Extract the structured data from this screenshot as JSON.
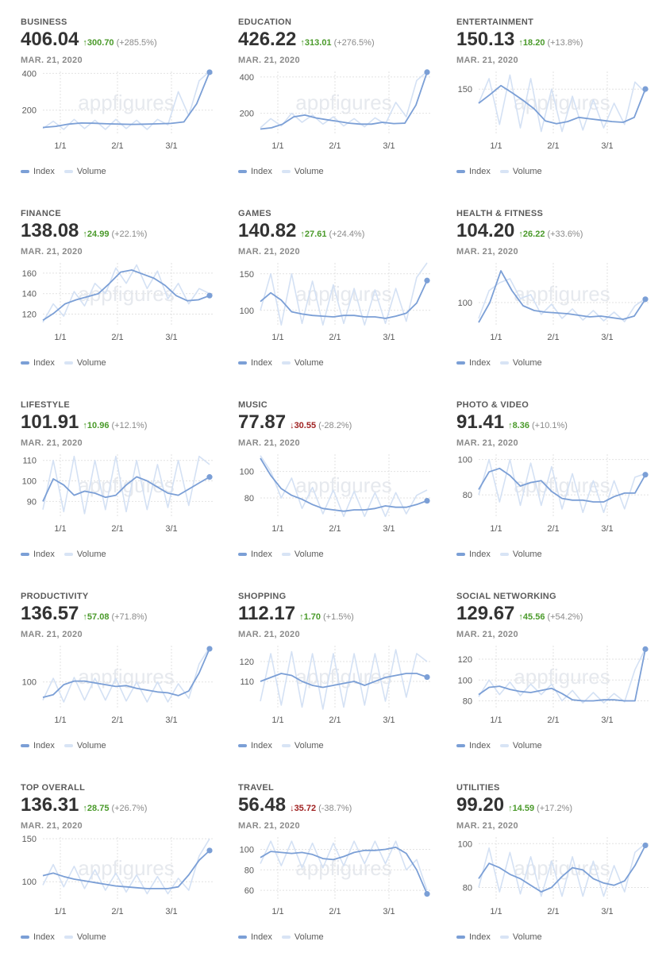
{
  "colors": {
    "index": "#7b9fd6",
    "volume": "#d4e1f4",
    "up": "#4a9a2a",
    "down": "#a02222",
    "grid": "#e2e2e2"
  },
  "icons": {
    "up": "↑",
    "down": "↓"
  },
  "panels": [
    {
      "category": "BUSINESS",
      "value": "406.04",
      "dir": "up",
      "change": "300.70",
      "pct": "(+285.5%)",
      "date": "MAR. 21, 2020",
      "legend": [
        "Index",
        "Volume"
      ],
      "watermark": "appfigures"
    },
    {
      "category": "EDUCATION",
      "value": "426.22",
      "dir": "up",
      "change": "313.01",
      "pct": "(+276.5%)",
      "date": "MAR. 21, 2020",
      "legend": [
        "Index",
        "Volume"
      ],
      "watermark": "appfigures"
    },
    {
      "category": "ENTERTAINMENT",
      "value": "150.13",
      "dir": "up",
      "change": "18.20",
      "pct": "(+13.8%)",
      "date": "MAR. 21, 2020",
      "legend": [
        "Index",
        "Volume"
      ],
      "watermark": "appfigures"
    },
    {
      "category": "FINANCE",
      "value": "138.08",
      "dir": "up",
      "change": "24.99",
      "pct": "(+22.1%)",
      "date": "MAR. 21, 2020",
      "legend": [
        "Index",
        "Volume"
      ],
      "watermark": "appfigures"
    },
    {
      "category": "GAMES",
      "value": "140.82",
      "dir": "up",
      "change": "27.61",
      "pct": "(+24.4%)",
      "date": "MAR. 21, 2020",
      "legend": [
        "Index",
        "Volume"
      ],
      "watermark": "appfigures"
    },
    {
      "category": "HEALTH & FITNESS",
      "value": "104.20",
      "dir": "up",
      "change": "26.22",
      "pct": "(+33.6%)",
      "date": "MAR. 21, 2020",
      "legend": [
        "Index",
        "Volume"
      ],
      "watermark": "appfigures"
    },
    {
      "category": "LIFESTYLE",
      "value": "101.91",
      "dir": "up",
      "change": "10.96",
      "pct": "(+12.1%)",
      "date": "MAR. 21, 2020",
      "legend": [
        "Index",
        "Volume"
      ],
      "watermark": "appfigures"
    },
    {
      "category": "MUSIC",
      "value": "77.87",
      "dir": "down",
      "change": "30.55",
      "pct": "(-28.2%)",
      "date": "MAR. 21, 2020",
      "legend": [
        "Index",
        "Volume"
      ],
      "watermark": "appfigures"
    },
    {
      "category": "PHOTO & VIDEO",
      "value": "91.41",
      "dir": "up",
      "change": "8.36",
      "pct": "(+10.1%)",
      "date": "MAR. 21, 2020",
      "legend": [
        "Index",
        "Volume"
      ],
      "watermark": "appfigures"
    },
    {
      "category": "PRODUCTIVITY",
      "value": "136.57",
      "dir": "up",
      "change": "57.08",
      "pct": "(+71.8%)",
      "date": "MAR. 21, 2020",
      "legend": [
        "Index",
        "Volume"
      ],
      "watermark": "appfigures"
    },
    {
      "category": "SHOPPING",
      "value": "112.17",
      "dir": "up",
      "change": "1.70",
      "pct": "(+1.5%)",
      "date": "MAR. 21, 2020",
      "legend": [
        "Index",
        "Volume"
      ],
      "watermark": "appfigures"
    },
    {
      "category": "SOCIAL NETWORKING",
      "value": "129.67",
      "dir": "up",
      "change": "45.56",
      "pct": "(+54.2%)",
      "date": "MAR. 21, 2020",
      "legend": [
        "Index",
        "Volume"
      ],
      "watermark": "appfigures"
    },
    {
      "category": "TOP OVERALL",
      "value": "136.31",
      "dir": "up",
      "change": "28.75",
      "pct": "(+26.7%)",
      "date": "MAR. 21, 2020",
      "legend": [
        "Index",
        "Volume"
      ],
      "watermark": "appfigures"
    },
    {
      "category": "TRAVEL",
      "value": "56.48",
      "dir": "down",
      "change": "35.72",
      "pct": "(-38.7%)",
      "date": "MAR. 21, 2020",
      "legend": [
        "Index",
        "Volume"
      ],
      "watermark": "appfigures"
    },
    {
      "category": "UTILITIES",
      "value": "99.20",
      "dir": "up",
      "change": "14.59",
      "pct": "(+17.2%)",
      "date": "MAR. 21, 2020",
      "legend": [
        "Index",
        "Volume"
      ],
      "watermark": "appfigures"
    }
  ],
  "chart_data": [
    {
      "type": "line",
      "title": "BUSINESS",
      "xticks": [
        "1/1",
        "2/1",
        "3/1"
      ],
      "yticks": [
        200,
        400
      ],
      "ylim": [
        65,
        410
      ],
      "series": [
        {
          "name": "Index",
          "values": [
            106,
            112,
            124,
            130,
            129,
            126,
            124,
            123,
            124,
            126,
            128,
            136,
            235,
            406.04
          ]
        },
        {
          "name": "Volume",
          "values": [
            100,
            140,
            95,
            150,
            100,
            145,
            95,
            150,
            100,
            145,
            95,
            150,
            120,
            300,
            170,
            360,
            410
          ]
        }
      ]
    },
    {
      "type": "line",
      "title": "EDUCATION",
      "xticks": [
        "1/1",
        "2/1",
        "3/1"
      ],
      "yticks": [
        200,
        400
      ],
      "ylim": [
        80,
        430
      ],
      "series": [
        {
          "name": "Index",
          "values": [
            113,
            120,
            140,
            180,
            190,
            174,
            164,
            155,
            145,
            140,
            140,
            150,
            143,
            145,
            245,
            426.22
          ]
        },
        {
          "name": "Volume",
          "values": [
            120,
            170,
            130,
            200,
            150,
            190,
            140,
            180,
            130,
            170,
            125,
            175,
            140,
            260,
            180,
            380,
            430
          ]
        }
      ]
    },
    {
      "type": "line",
      "title": "ENTERTAINMENT",
      "xticks": [
        "1/1",
        "2/1",
        "3/1"
      ],
      "yticks": [
        150
      ],
      "ylim": [
        85,
        175
      ],
      "series": [
        {
          "name": "Index",
          "values": [
            130,
            142,
            155,
            145,
            134,
            122,
            105,
            101,
            104,
            110,
            108,
            106,
            104,
            103,
            110,
            150.13
          ]
        },
        {
          "name": "Volume",
          "values": [
            130,
            165,
            100,
            170,
            95,
            165,
            90,
            150,
            90,
            140,
            92,
            135,
            95,
            130,
            100,
            160,
            145
          ]
        }
      ]
    },
    {
      "type": "line",
      "title": "FINANCE",
      "xticks": [
        "1/1",
        "2/1",
        "3/1"
      ],
      "yticks": [
        120,
        140,
        160
      ],
      "ylim": [
        108,
        170
      ],
      "series": [
        {
          "name": "Index",
          "values": [
            114,
            121,
            130,
            134,
            137,
            140,
            150,
            161,
            163,
            159,
            155,
            148,
            138,
            133,
            134,
            138.08
          ]
        },
        {
          "name": "Volume",
          "values": [
            112,
            130,
            118,
            142,
            128,
            150,
            140,
            165,
            150,
            168,
            145,
            162,
            135,
            150,
            130,
            145,
            140
          ]
        }
      ]
    },
    {
      "type": "line",
      "title": "GAMES",
      "xticks": [
        "1/1",
        "2/1",
        "3/1"
      ],
      "yticks": [
        100,
        150
      ],
      "ylim": [
        78,
        165
      ],
      "series": [
        {
          "name": "Index",
          "values": [
            112,
            124,
            114,
            98,
            95,
            93,
            92,
            91,
            93,
            93,
            91,
            91,
            89,
            92,
            96,
            110,
            140.82
          ]
        },
        {
          "name": "Volume",
          "values": [
            100,
            150,
            80,
            150,
            82,
            140,
            80,
            135,
            82,
            130,
            80,
            128,
            82,
            130,
            85,
            145,
            165
          ]
        }
      ]
    },
    {
      "type": "line",
      "title": "HEALTH & FITNESS",
      "xticks": [
        "1/1",
        "2/1",
        "3/1"
      ],
      "yticks": [
        100
      ],
      "ylim": [
        70,
        150
      ],
      "series": [
        {
          "name": "Index",
          "values": [
            75,
            100,
            140,
            115,
            96,
            90,
            88,
            87,
            86,
            84,
            82,
            83,
            81,
            79,
            83,
            104.2
          ]
        },
        {
          "name": "Volume",
          "values": [
            80,
            115,
            125,
            130,
            105,
            110,
            85,
            98,
            80,
            92,
            78,
            90,
            77,
            88,
            76,
            96,
            105
          ]
        }
      ]
    },
    {
      "type": "line",
      "title": "LIFESTYLE",
      "xticks": [
        "1/1",
        "2/1",
        "3/1"
      ],
      "yticks": [
        90,
        100,
        110
      ],
      "ylim": [
        82,
        113
      ],
      "series": [
        {
          "name": "Index",
          "values": [
            90,
            101,
            98,
            93,
            95,
            94,
            92,
            93,
            98,
            102,
            100,
            97,
            94,
            93,
            96,
            99,
            101.91
          ]
        },
        {
          "name": "Volume",
          "values": [
            86,
            110,
            85,
            112,
            84,
            110,
            86,
            112,
            85,
            110,
            86,
            108,
            87,
            110,
            88,
            112,
            108
          ]
        }
      ]
    },
    {
      "type": "line",
      "title": "MUSIC",
      "xticks": [
        "1/1",
        "2/1",
        "3/1"
      ],
      "yticks": [
        80,
        100
      ],
      "ylim": [
        65,
        113
      ],
      "series": [
        {
          "name": "Index",
          "values": [
            110,
            97,
            87,
            82,
            79,
            75,
            72,
            71,
            70,
            71,
            71,
            72,
            74,
            73,
            73,
            75,
            77.87
          ]
        },
        {
          "name": "Volume",
          "values": [
            112,
            100,
            80,
            95,
            72,
            88,
            68,
            86,
            66,
            85,
            66,
            84,
            66,
            84,
            68,
            82,
            86
          ]
        }
      ]
    },
    {
      "type": "line",
      "title": "PHOTO & VIDEO",
      "xticks": [
        "1/1",
        "2/1",
        "3/1"
      ],
      "yticks": [
        80,
        100
      ],
      "ylim": [
        67,
        103
      ],
      "series": [
        {
          "name": "Index",
          "values": [
            83,
            93,
            95,
            91,
            85,
            87,
            88,
            82,
            78,
            77,
            77,
            76,
            76,
            79,
            81,
            81,
            91.41
          ]
        },
        {
          "name": "Volume",
          "values": [
            80,
            100,
            76,
            100,
            74,
            98,
            74,
            96,
            72,
            92,
            70,
            88,
            70,
            88,
            72,
            90,
            92
          ]
        }
      ]
    },
    {
      "type": "line",
      "title": "PRODUCTIVITY",
      "xticks": [
        "1/1",
        "2/1",
        "3/1"
      ],
      "yticks": [
        100
      ],
      "ylim": [
        70,
        140
      ],
      "series": [
        {
          "name": "Index",
          "values": [
            83,
            86,
            97,
            101,
            101,
            99,
            97,
            95,
            96,
            93,
            91,
            89,
            88,
            85,
            90,
            110,
            136.57
          ]
        },
        {
          "name": "Volume",
          "values": [
            80,
            104,
            78,
            105,
            80,
            104,
            80,
            104,
            79,
            100,
            78,
            100,
            78,
            98,
            82,
            120,
            138
          ]
        }
      ]
    },
    {
      "type": "line",
      "title": "SHOPPING",
      "xticks": [
        "1/1",
        "2/1",
        "3/1"
      ],
      "yticks": [
        110,
        120
      ],
      "ylim": [
        96,
        128
      ],
      "series": [
        {
          "name": "Index",
          "values": [
            110,
            112,
            114,
            113,
            110,
            108,
            107,
            108,
            109,
            110,
            108,
            110,
            112,
            113,
            114,
            114,
            112.17
          ]
        },
        {
          "name": "Volume",
          "values": [
            100,
            124,
            98,
            125,
            97,
            124,
            96,
            124,
            97,
            124,
            98,
            124,
            100,
            126,
            102,
            124,
            120
          ]
        }
      ]
    },
    {
      "type": "line",
      "title": "SOCIAL NETWORKING",
      "xticks": [
        "1/1",
        "2/1",
        "3/1"
      ],
      "yticks": [
        80,
        100,
        120
      ],
      "ylim": [
        72,
        133
      ],
      "series": [
        {
          "name": "Index",
          "values": [
            86,
            93,
            94,
            91,
            89,
            88,
            90,
            92,
            87,
            81,
            80,
            80,
            81,
            81,
            80,
            80,
            129.67
          ]
        },
        {
          "name": "Volume",
          "values": [
            84,
            100,
            86,
            98,
            85,
            96,
            86,
            96,
            80,
            90,
            78,
            88,
            78,
            87,
            79,
            110,
            130
          ]
        }
      ]
    },
    {
      "type": "line",
      "title": "TOP OVERALL",
      "xticks": [
        "1/1",
        "2/1",
        "3/1"
      ],
      "yticks": [
        100,
        150
      ],
      "ylim": [
        78,
        152
      ],
      "series": [
        {
          "name": "Index",
          "values": [
            107,
            110,
            106,
            103,
            101,
            99,
            97,
            95,
            94,
            93,
            92,
            92,
            92,
            94,
            108,
            125,
            136.31
          ]
        },
        {
          "name": "Volume",
          "values": [
            96,
            120,
            94,
            118,
            92,
            114,
            90,
            110,
            88,
            108,
            86,
            106,
            86,
            104,
            90,
            130,
            150
          ]
        }
      ]
    },
    {
      "type": "line",
      "title": "TRAVEL",
      "xticks": [
        "1/1",
        "2/1",
        "3/1"
      ],
      "yticks": [
        60,
        80,
        100
      ],
      "ylim": [
        50,
        112
      ],
      "series": [
        {
          "name": "Index",
          "values": [
            92,
            98,
            97,
            96,
            97,
            95,
            91,
            90,
            93,
            97,
            99,
            99,
            100,
            102,
            96,
            80,
            56.48
          ]
        },
        {
          "name": "Volume",
          "values": [
            86,
            108,
            84,
            108,
            82,
            106,
            82,
            106,
            84,
            108,
            86,
            108,
            86,
            108,
            80,
            90,
            60
          ]
        }
      ]
    },
    {
      "type": "line",
      "title": "UTILITIES",
      "xticks": [
        "1/1",
        "2/1",
        "3/1"
      ],
      "yticks": [
        80,
        100
      ],
      "ylim": [
        74,
        103
      ],
      "series": [
        {
          "name": "Index",
          "values": [
            84,
            91,
            89,
            86,
            84,
            81,
            78,
            80,
            85,
            89,
            88,
            84,
            82,
            81,
            83,
            90,
            99.2
          ]
        },
        {
          "name": "Volume",
          "values": [
            80,
            98,
            78,
            96,
            77,
            94,
            76,
            92,
            76,
            94,
            76,
            92,
            76,
            90,
            78,
            96,
            100
          ]
        }
      ]
    }
  ]
}
